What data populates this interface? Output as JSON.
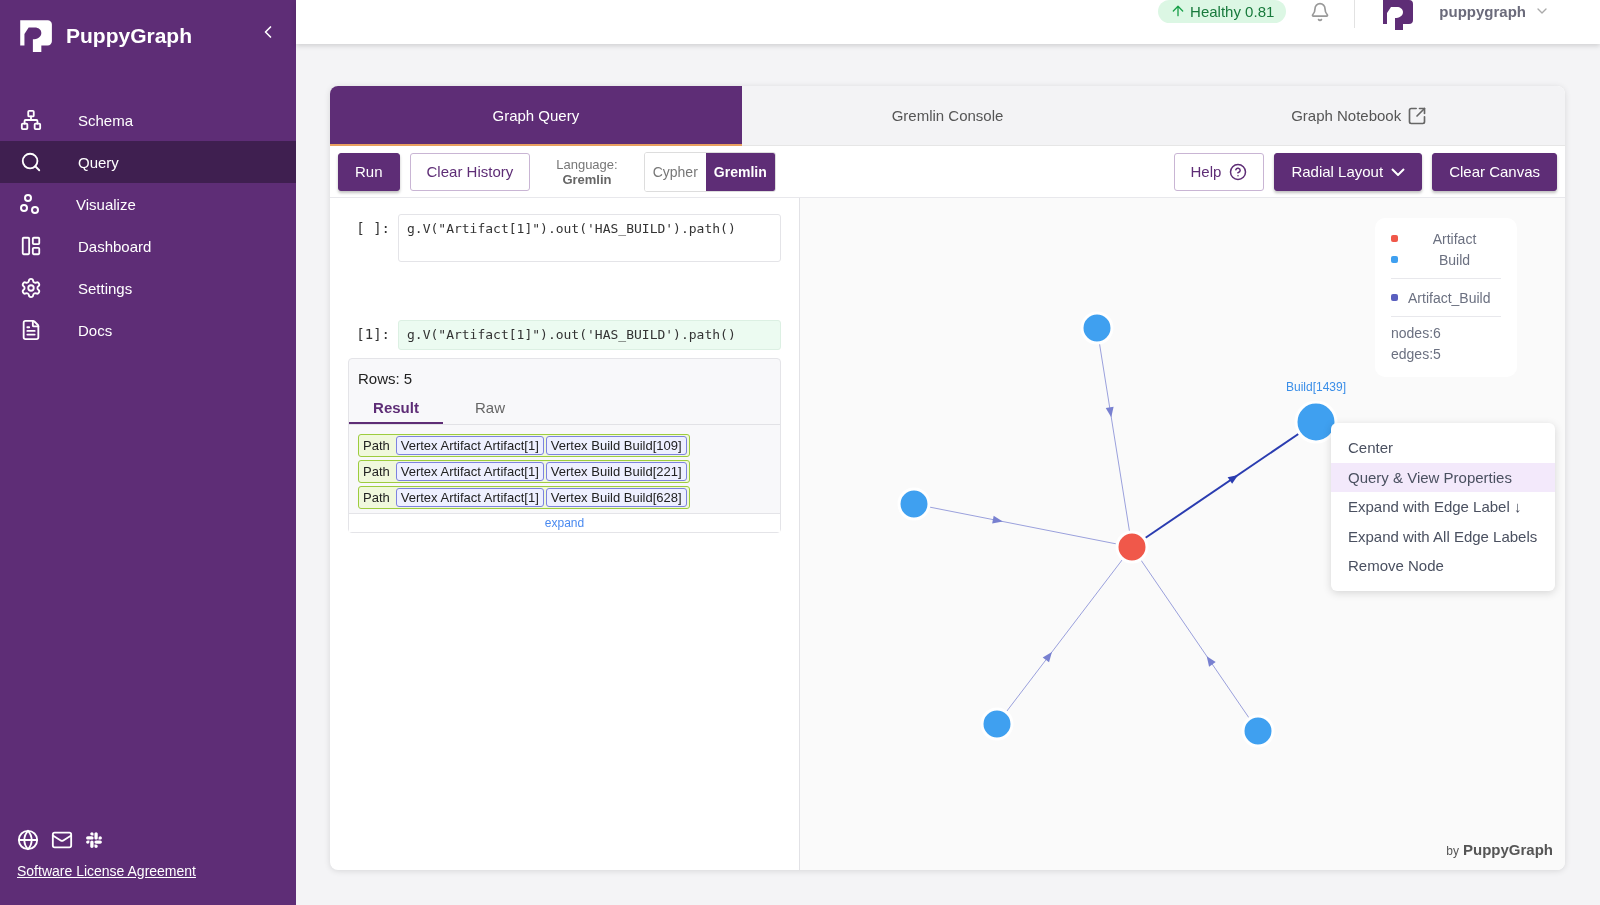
{
  "sidebar": {
    "brand": "PuppyGraph",
    "items": [
      {
        "label": "Schema",
        "selected": false
      },
      {
        "label": "Query",
        "selected": true
      },
      {
        "label": "Visualize",
        "selected": false
      },
      {
        "label": "Dashboard",
        "selected": false
      },
      {
        "label": "Settings",
        "selected": false
      },
      {
        "label": "Docs",
        "selected": false
      }
    ],
    "footer_link": "Software License Agreement"
  },
  "topbar": {
    "health": "Healthy 0.81",
    "user": "puppygraph"
  },
  "tabs": [
    {
      "label": "Graph Query",
      "selected": true,
      "external": false
    },
    {
      "label": "Gremlin Console",
      "selected": false,
      "external": false
    },
    {
      "label": "Graph Notebook",
      "selected": false,
      "external": true
    }
  ],
  "toolbar": {
    "run": "Run",
    "clear_history": "Clear History",
    "language_label": "Language:",
    "language_value": "Gremlin",
    "languages": [
      {
        "label": "Cypher",
        "selected": false
      },
      {
        "label": "Gremlin",
        "selected": true
      }
    ],
    "help": "Help",
    "layout": "Radial Layout",
    "clear_canvas": "Clear Canvas"
  },
  "cells": [
    {
      "prompt": "[ ]:",
      "code": "g.V(\"Artifact[1]\").out('HAS_BUILD').path()",
      "executed": false
    },
    {
      "prompt": "[1]:",
      "code": "g.V(\"Artifact[1]\").out('HAS_BUILD').path()",
      "executed": true
    }
  ],
  "result": {
    "rows": "Rows: 5",
    "tabs": [
      {
        "label": "Result",
        "selected": true
      },
      {
        "label": "Raw",
        "selected": false
      }
    ],
    "paths": [
      {
        "label": "Path",
        "vertices": [
          "Vertex Artifact Artifact[1]",
          "Vertex Build Build[109]"
        ]
      },
      {
        "label": "Path",
        "vertices": [
          "Vertex Artifact Artifact[1]",
          "Vertex Build Build[221]"
        ]
      },
      {
        "label": "Path",
        "vertices": [
          "Vertex Artifact Artifact[1]",
          "Vertex Build Build[628]"
        ]
      }
    ],
    "expand": "expand"
  },
  "graph": {
    "node_label": "Build[1439]",
    "legend_nodes": [
      {
        "label": "Artifact",
        "color": "#f0584a"
      },
      {
        "label": "Build",
        "color": "#3fa0f0"
      }
    ],
    "legend_edges": [
      {
        "label": "Artifact_Build",
        "color": "#5a5fbf"
      }
    ],
    "stats": [
      "nodes:6",
      "edges:5"
    ],
    "menu": [
      {
        "label": "Center",
        "selected": false
      },
      {
        "label": "Query & View Properties",
        "selected": true
      },
      {
        "label": "Expand with Edge Label ↓",
        "selected": false
      },
      {
        "label": "Expand with All Edge Labels",
        "selected": false
      },
      {
        "label": "Remove Node",
        "selected": false
      }
    ],
    "credit_prefix": "by",
    "credit_brand": "PuppyGraph"
  }
}
